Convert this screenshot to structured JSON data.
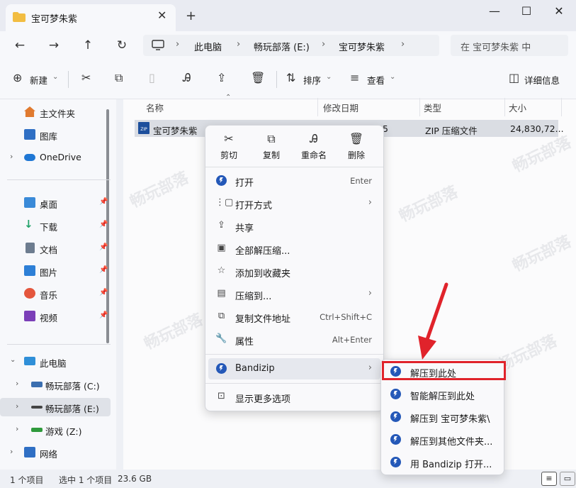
{
  "window": {
    "tab_title": "宝可梦朱紫",
    "new_tab": "+",
    "minimize": "—",
    "maximize": "☐",
    "close": "✕"
  },
  "nav": {
    "back": "←",
    "forward": "→",
    "up": "↑",
    "refresh": "↻"
  },
  "address": {
    "crumbs": [
      "此电脑",
      "畅玩部落 (E:)",
      "宝可梦朱紫"
    ],
    "search_placeholder": "在 宝可梦朱紫 中"
  },
  "toolbar": {
    "new_label": "新建",
    "sort_label": "排序",
    "view_label": "查看",
    "details_label": "详细信息"
  },
  "sidebar": {
    "items": [
      {
        "label": "主文件夹",
        "icon": "home-icon",
        "color": "#e07a2f"
      },
      {
        "label": "图库",
        "icon": "gallery-icon",
        "color": "#2f6fc4"
      },
      {
        "label": "OneDrive",
        "icon": "cloud-icon",
        "color": "#1f77d4"
      },
      {
        "label": "桌面",
        "icon": "desktop-icon",
        "color": "#3a8ad8"
      },
      {
        "label": "下载",
        "icon": "download-icon",
        "color": "#23a36b"
      },
      {
        "label": "文档",
        "icon": "documents-icon",
        "color": "#6d7c8f"
      },
      {
        "label": "图片",
        "icon": "pictures-icon",
        "color": "#2d7fd6"
      },
      {
        "label": "音乐",
        "icon": "music-icon",
        "color": "#e4563d"
      },
      {
        "label": "视频",
        "icon": "video-icon",
        "color": "#7b3fb8"
      },
      {
        "label": "此电脑",
        "icon": "pc-icon",
        "color": "#2f8fd8"
      },
      {
        "label": "畅玩部落 (C:)",
        "icon": "drive-icon",
        "color": "#3b6fb0"
      },
      {
        "label": "畅玩部落 (E:)",
        "icon": "drive-icon",
        "color": "#444"
      },
      {
        "label": "游戏 (Z:)",
        "icon": "drive-icon",
        "color": "#2f9a3c"
      },
      {
        "label": "网络",
        "icon": "network-icon",
        "color": "#2f6fc4"
      }
    ]
  },
  "columns": {
    "name": "名称",
    "date": "修改日期",
    "type": "类型",
    "size": "大小"
  },
  "file": {
    "name": "宝可梦朱紫",
    "date_fragment": "5",
    "type": "ZIP 压缩文件",
    "size": "24,830,72..."
  },
  "context_menu": {
    "quick_actions": [
      "剪切",
      "复制",
      "重命名",
      "删除"
    ],
    "items": [
      {
        "label": "打开",
        "hint": "Enter"
      },
      {
        "label": "打开方式",
        "hint": "›"
      },
      {
        "label": "共享",
        "hint": ""
      },
      {
        "label": "全部解压缩...",
        "hint": ""
      },
      {
        "label": "添加到收藏夹",
        "hint": ""
      },
      {
        "label": "压缩到...",
        "hint": "›"
      },
      {
        "label": "复制文件地址",
        "hint": "Ctrl+Shift+C"
      },
      {
        "label": "属性",
        "hint": "Alt+Enter"
      }
    ],
    "bandizip": "Bandizip",
    "more_options": "显示更多选项"
  },
  "submenu": {
    "items": [
      "解压到此处",
      "智能解压到此处",
      "解压到 宝可梦朱紫\\",
      "解压到其他文件夹...",
      "用 Bandizip 打开..."
    ]
  },
  "status": {
    "count": "1 个项目",
    "selected": "选中 1 个项目",
    "size": "23.6 GB"
  },
  "colors": {
    "highlight": "#e0232b",
    "accent": "#2458b8"
  }
}
